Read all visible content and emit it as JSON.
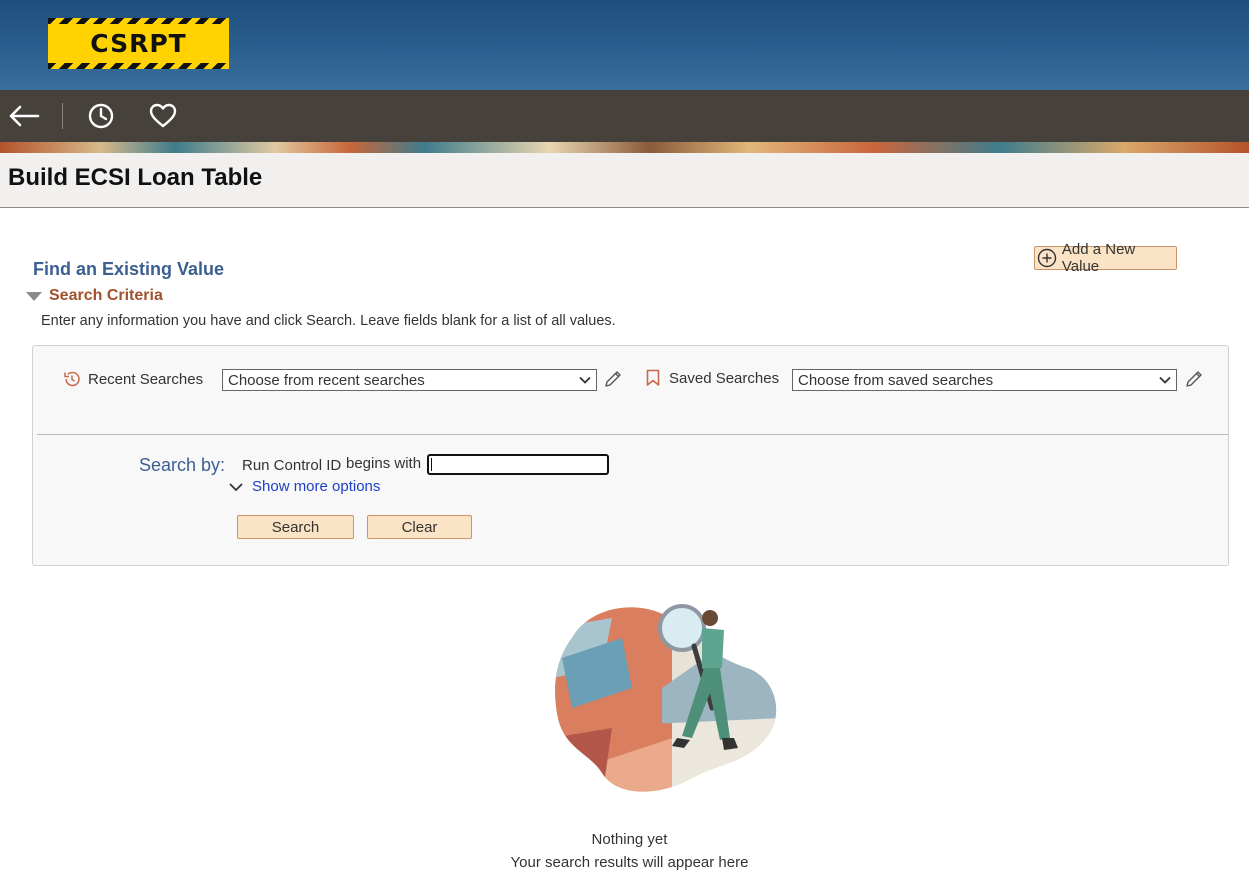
{
  "banner": {
    "logo_text": "CSRPT"
  },
  "nav": {
    "back_icon": "arrow-left-icon",
    "recent_icon": "clock-icon",
    "favorites_icon": "heart-icon"
  },
  "page": {
    "title": "Build ECSI Loan Table"
  },
  "find": {
    "heading": "Find an Existing Value",
    "add_new_label": "Add a New Value",
    "criteria_label": "Search Criteria",
    "instructions": "Enter any information you have and click Search. Leave fields blank for a list of all values."
  },
  "search_panel": {
    "recent_label": "Recent Searches",
    "recent_placeholder": "Choose from recent searches",
    "saved_label": "Saved Searches",
    "saved_placeholder": "Choose from saved searches",
    "search_by_label": "Search by:",
    "field_label": "Run Control ID",
    "operator": "begins with",
    "field_value": "",
    "more_options_label": "Show more options",
    "search_button": "Search",
    "clear_button": "Clear"
  },
  "empty_state": {
    "line1": "Nothing yet",
    "line2": "Your search results will appear here"
  },
  "colors": {
    "banner": "#2b5f8f",
    "navbar": "#47413c",
    "heading_blue": "#3c5f92",
    "criteria_orange": "#a0522d",
    "button_bg": "#fbe3c6",
    "link_blue": "#1f3fc6"
  }
}
